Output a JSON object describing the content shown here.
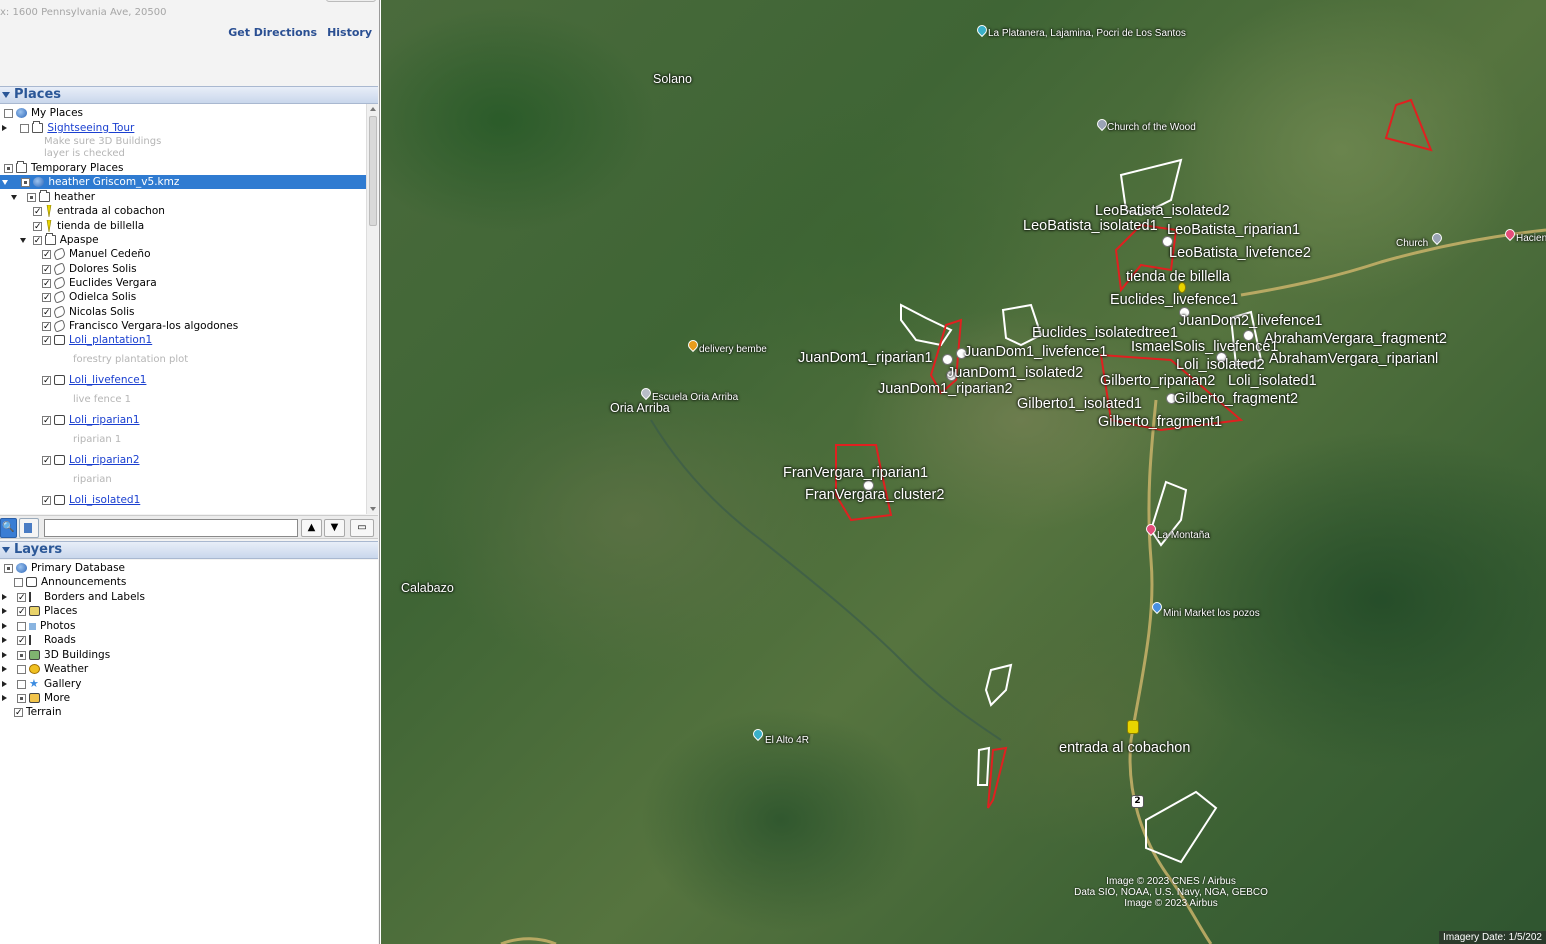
{
  "search": {
    "hint": "x: 1600 Pennsylvania Ave, 20500",
    "get_directions": "Get Directions",
    "history": "History"
  },
  "places_panel": {
    "title": "Places",
    "rows": [
      {
        "label": "My Places",
        "link": false
      },
      {
        "label": "Sightseeing Tour",
        "link": true
      },
      {
        "label": "Make sure 3D Buildings",
        "desc": true
      },
      {
        "label": "layer is checked",
        "desc": true
      },
      {
        "label": "Temporary Places",
        "link": false
      },
      {
        "label": "heather Griscom_v5.kmz",
        "link": false
      },
      {
        "label": "heather",
        "link": false
      },
      {
        "label": "entrada al cobachon",
        "link": false
      },
      {
        "label": "tienda de billella",
        "link": false
      },
      {
        "label": "Apaspe",
        "link": false
      },
      {
        "label": "Manuel Cedeño",
        "link": false
      },
      {
        "label": "Dolores Solis",
        "link": false
      },
      {
        "label": "Euclides Vergara",
        "link": false
      },
      {
        "label": "Odielca Solis",
        "link": false
      },
      {
        "label": "Nicolas Solis",
        "link": false
      },
      {
        "label": "Francisco Vergara-los algodones",
        "link": false
      },
      {
        "label": "Loli_plantation1",
        "link": true
      },
      {
        "label": "forestry plantation plot",
        "desc": true
      },
      {
        "label": "Loli_livefence1",
        "link": true
      },
      {
        "label": "live fence 1",
        "desc": true
      },
      {
        "label": "Loli_riparian1",
        "link": true
      },
      {
        "label": "riparian 1",
        "desc": true
      },
      {
        "label": "Loli_riparian2",
        "link": true
      },
      {
        "label": "riparian",
        "desc": true
      },
      {
        "label": "Loli_isolated1",
        "link": true
      }
    ]
  },
  "layers_panel": {
    "title": "Layers",
    "rows": [
      {
        "label": "Primary Database"
      },
      {
        "label": "Announcements"
      },
      {
        "label": "Borders and Labels"
      },
      {
        "label": "Places"
      },
      {
        "label": "Photos"
      },
      {
        "label": "Roads"
      },
      {
        "label": "3D Buildings"
      },
      {
        "label": "Weather"
      },
      {
        "label": "Gallery"
      },
      {
        "label": "More"
      },
      {
        "label": "Terrain"
      }
    ]
  },
  "map": {
    "places": [
      "Solano",
      "Calabazo",
      "Oria Arriba"
    ],
    "pois": [
      "La Platanera, Lajamina, Pocri de Los Santos",
      "Church of the Wood",
      "Church",
      "Hacien",
      "delivery bembe",
      "Escuela Oria Arriba",
      "La Montaña",
      "Mini Market los pozos",
      "El Alto 4R"
    ],
    "kml_labels": [
      "LeoBatista_isolated2",
      "LeoBatista_isolated1",
      "LeoBatista_riparian1",
      "LeoBatista_livefence2",
      "tienda de billella",
      "Euclides_livefence1",
      "JuanDom2_livefence1",
      "Euclides_isolatedtree1",
      "AbrahamVergara_fragment2",
      "IsmaelSolis_livefence1",
      "AbrahamVergara_riparianl",
      "Loli_isolated2",
      "JuanDom1_riparian1",
      "JuanDom1_livefence1",
      "JuanDom1_isolated2",
      "JuanDom1_riparian2",
      "Gilberto_riparian2",
      "Loli_isolated1",
      "Gilberto1_isolated1",
      "Gilberto_fragment2",
      "Gilberto_fragment1",
      "FranVergara_riparian1",
      "FranVergara_cluster2",
      "entrada al cobachon"
    ],
    "route_number": "2",
    "credits": [
      "Image © 2023 CNES / Airbus",
      "Data SIO, NOAA, U.S. Navy, NGA, GEBCO",
      "Image © 2023 Airbus"
    ],
    "imagery_date": "Imagery Date: 1/5/202"
  }
}
